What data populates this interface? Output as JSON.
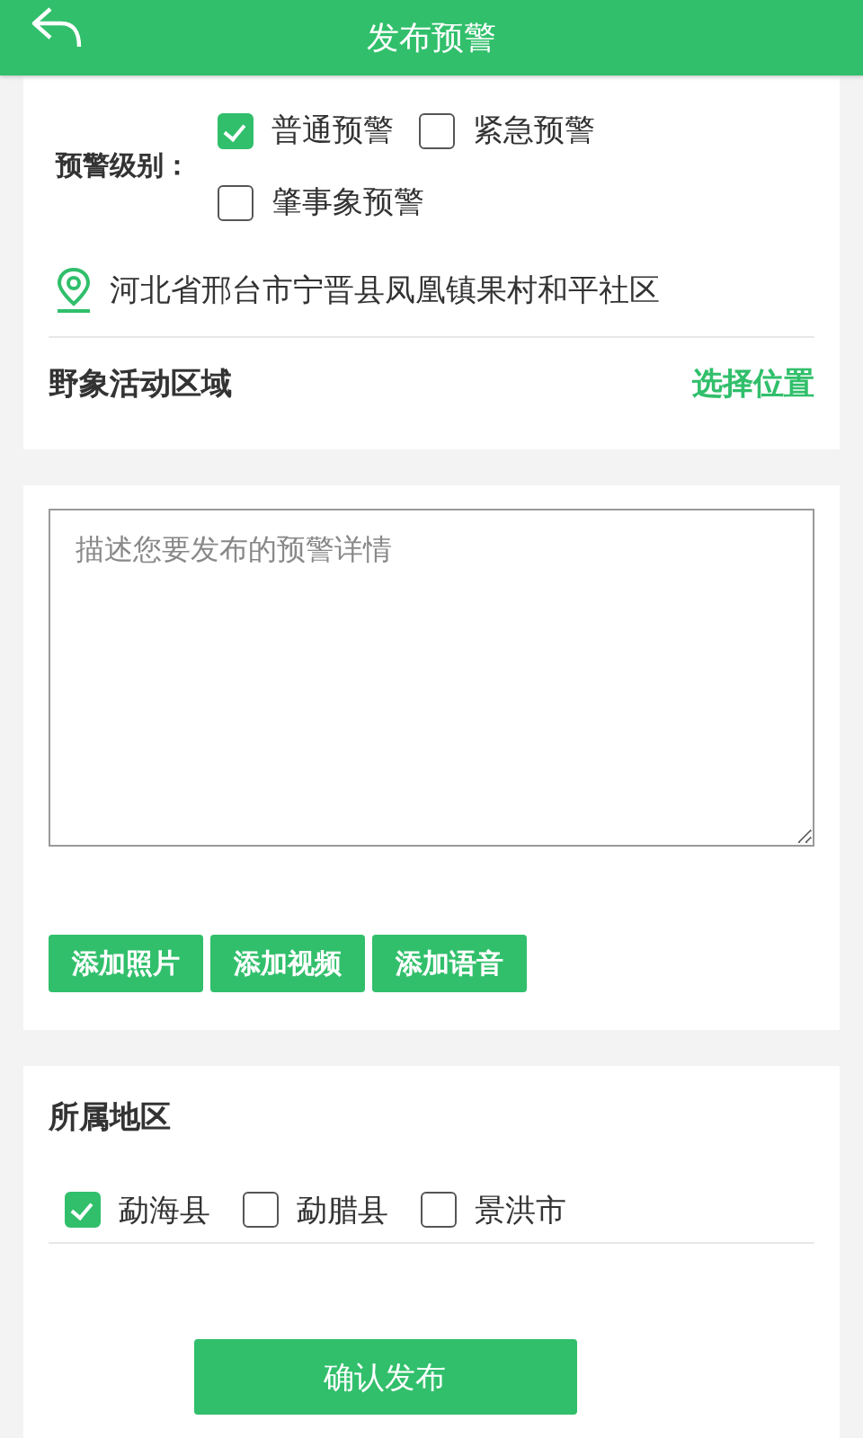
{
  "header": {
    "title": "发布预警"
  },
  "warning_level": {
    "label": "预警级别：",
    "options": [
      {
        "label": "普通预警",
        "checked": true
      },
      {
        "label": "紧急预警",
        "checked": false
      },
      {
        "label": "肇事象预警",
        "checked": false
      }
    ]
  },
  "location": {
    "address": "河北省邢台市宁晋县凤凰镇果村和平社区"
  },
  "activity_area": {
    "label": "野象活动区域",
    "action": "选择位置"
  },
  "description": {
    "placeholder": "描述您要发布的预警详情"
  },
  "media_buttons": [
    "添加照片",
    "添加视频",
    "添加语音"
  ],
  "region": {
    "title": "所属地区",
    "options": [
      {
        "label": "勐海县",
        "checked": true
      },
      {
        "label": "勐腊县",
        "checked": false
      },
      {
        "label": "景洪市",
        "checked": false
      }
    ]
  },
  "submit": "确认发布"
}
